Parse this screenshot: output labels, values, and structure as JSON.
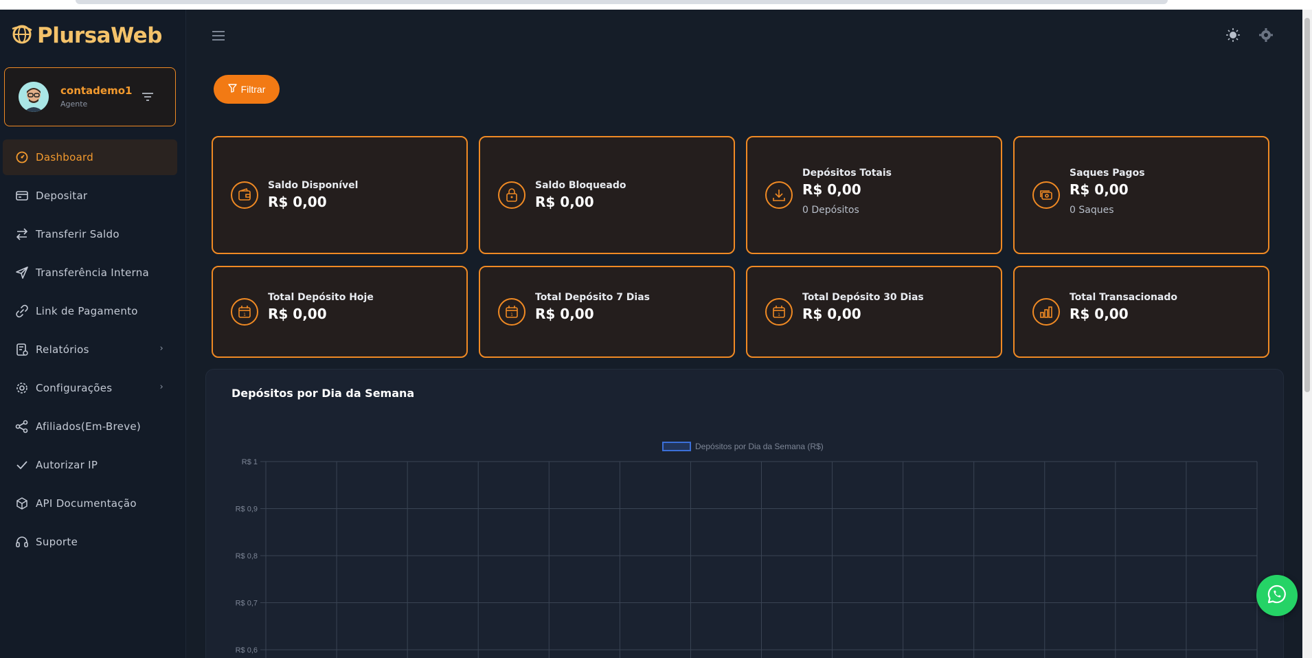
{
  "app": {
    "name": "PlursaWeb"
  },
  "profile": {
    "username": "contademo1",
    "role": "Agente"
  },
  "nav": {
    "items": [
      {
        "label": "Dashboard",
        "icon": "dashboard-icon",
        "active": true
      },
      {
        "label": "Depositar",
        "icon": "wallet-card-icon"
      },
      {
        "label": "Transferir Saldo",
        "icon": "transfer-arrows-icon"
      },
      {
        "label": "Transferência Interna",
        "icon": "send-icon"
      },
      {
        "label": "Link de Pagamento",
        "icon": "link-icon"
      },
      {
        "label": "Relatórios",
        "icon": "report-icon",
        "has_submenu": true
      },
      {
        "label": "Configurações",
        "icon": "gear-icon",
        "has_submenu": true
      },
      {
        "label": "Afiliados(Em-Breve)",
        "icon": "share-icon"
      },
      {
        "label": "Autorizar IP",
        "icon": "check-icon"
      },
      {
        "label": "API Documentação",
        "icon": "cube-icon"
      },
      {
        "label": "Suporte",
        "icon": "headset-icon"
      }
    ]
  },
  "toolbar": {
    "filter_label": "Filtrar"
  },
  "cards": [
    {
      "title": "Saldo Disponível",
      "value": "R$ 0,00",
      "icon": "wallet-icon"
    },
    {
      "title": "Saldo Bloqueado",
      "value": "R$ 0,00",
      "icon": "lock-icon"
    },
    {
      "title": "Depósitos Totais",
      "value": "R$ 0,00",
      "sub": "0 Depósitos",
      "icon": "download-icon"
    },
    {
      "title": "Saques Pagos",
      "value": "R$ 0,00",
      "sub": "0 Saques",
      "icon": "cash-icon"
    },
    {
      "title": "Total Depósito Hoje",
      "value": "R$ 0,00",
      "icon": "calendar-icon"
    },
    {
      "title": "Total Depósito 7 Dias",
      "value": "R$ 0,00",
      "icon": "calendar-icon"
    },
    {
      "title": "Total Depósito 30 Dias",
      "value": "R$ 0,00",
      "icon": "calendar-icon"
    },
    {
      "title": "Total Transacionado",
      "value": "R$ 0,00",
      "icon": "bar-chart-icon"
    }
  ],
  "chart_panel": {
    "title": "Depósitos por Dia da Semana"
  },
  "chart_data": {
    "type": "bar",
    "title": "",
    "series": [
      {
        "name": "Depósitos por Dia da Semana (R$)",
        "values": []
      }
    ],
    "categories": [],
    "y_tick_labels": [
      "R$ 1",
      "R$ 0,9",
      "R$ 0,8",
      "R$ 0,7",
      "R$ 0,6"
    ],
    "ylim": [
      0,
      1
    ],
    "grid": true,
    "legend_position": "top-center",
    "colors": {
      "series": "#3b6fd8",
      "grid": "#3a4454",
      "tick": "#7d8696"
    }
  },
  "colors": {
    "accent": "#f27a14",
    "card_border": "#f08a24",
    "background": "#151d28",
    "whatsapp": "#25d366"
  }
}
